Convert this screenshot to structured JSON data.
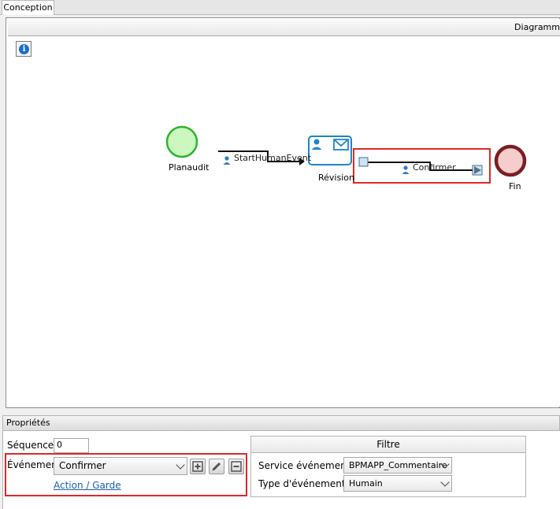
{
  "tabs": [
    {
      "label": "Conception",
      "active": true
    }
  ],
  "diagram": {
    "header_title": "Diagramm",
    "nodes": {
      "start": {
        "label": "Planaudit"
      },
      "task": {
        "label": "Révision"
      },
      "end": {
        "label": "Fin"
      }
    },
    "flows": {
      "flow1": {
        "label": "StartHumanEvent"
      },
      "flow2": {
        "label": "Confirmer"
      }
    }
  },
  "properties": {
    "title": "Propriétés",
    "sequence": {
      "label": "Séquence",
      "value": "0"
    },
    "event": {
      "label": "Événement",
      "selected": "Confirmer"
    },
    "action_link": "Action / Garde",
    "filter": {
      "title": "Filtre",
      "service": {
        "label": "Service événementiel",
        "selected": "BPMAPP_Commentaire"
      },
      "event_type": {
        "label": "Type d'événement",
        "selected": "Humain"
      }
    }
  },
  "colors": {
    "start_fill": "#ccf8c0",
    "start_stroke": "#2db52d",
    "end_fill": "#f6cccc",
    "end_stroke": "#7a1e22",
    "task_stroke": "#1e86c8",
    "highlight": "#e02828"
  }
}
